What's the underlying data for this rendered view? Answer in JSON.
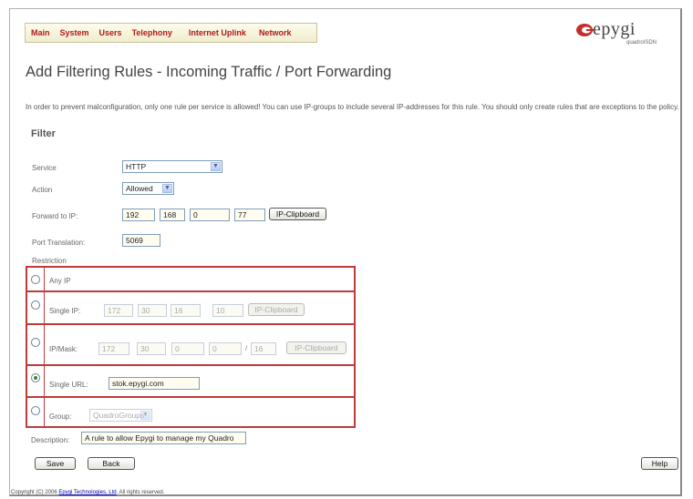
{
  "nav": {
    "items": [
      "Main",
      "System",
      "Users",
      "Telephony",
      "Internet Uplink",
      "Network"
    ]
  },
  "logo": {
    "brand": "epygi",
    "sub": "quadroISDN",
    "color": "#c0302a"
  },
  "page": {
    "title": "Add Filtering Rules - Incoming Traffic / Port Forwarding",
    "description": "In order to prevent malconfiguration, only one rule per service is allowed! You can use IP-groups to include several IP-addresses for this rule. You should only create rules that are exceptions to the policy."
  },
  "filter": {
    "section_title": "Filter",
    "service": {
      "label": "Service",
      "value": "HTTP"
    },
    "action": {
      "label": "Action",
      "value": "Allowed"
    },
    "forward": {
      "label": "Forward to IP:",
      "octets": [
        "192",
        "168",
        "0",
        "77"
      ],
      "clipboard": "IP-Clipboard"
    },
    "port": {
      "label": "Port Translation:",
      "value": "5069"
    }
  },
  "restriction": {
    "title": "Restriction",
    "any_ip": {
      "label": "Any IP",
      "selected": false
    },
    "single_ip": {
      "label": "Single IP:",
      "octets": [
        "172",
        "30",
        "16",
        "10"
      ],
      "clipboard": "IP-Clipboard",
      "selected": false
    },
    "ip_mask": {
      "label": "IP/Mask:",
      "octets": [
        "172",
        "30",
        "0",
        "0"
      ],
      "mask": "16",
      "clipboard": "IP-Clipboard",
      "selected": false
    },
    "single_url": {
      "label": "Single URL:",
      "value": "stok.epygi.com",
      "selected": true
    },
    "group": {
      "label": "Group:",
      "value": "QuadroGroups",
      "selected": false
    }
  },
  "description_field": {
    "label": "Description:",
    "value": "A rule to allow Epygi to manage my Quadro"
  },
  "buttons": {
    "save": "Save",
    "back": "Back",
    "help": "Help"
  },
  "footer": {
    "prefix": "Copyright (C) 2006 ",
    "company": "Epygi Technologies, Ltd",
    "suffix": ". All rights reserved."
  },
  "colors": {
    "nav_text": "#b01a1a",
    "row_border": "#c03a3a",
    "radio_checked": "#2d8a2d"
  }
}
